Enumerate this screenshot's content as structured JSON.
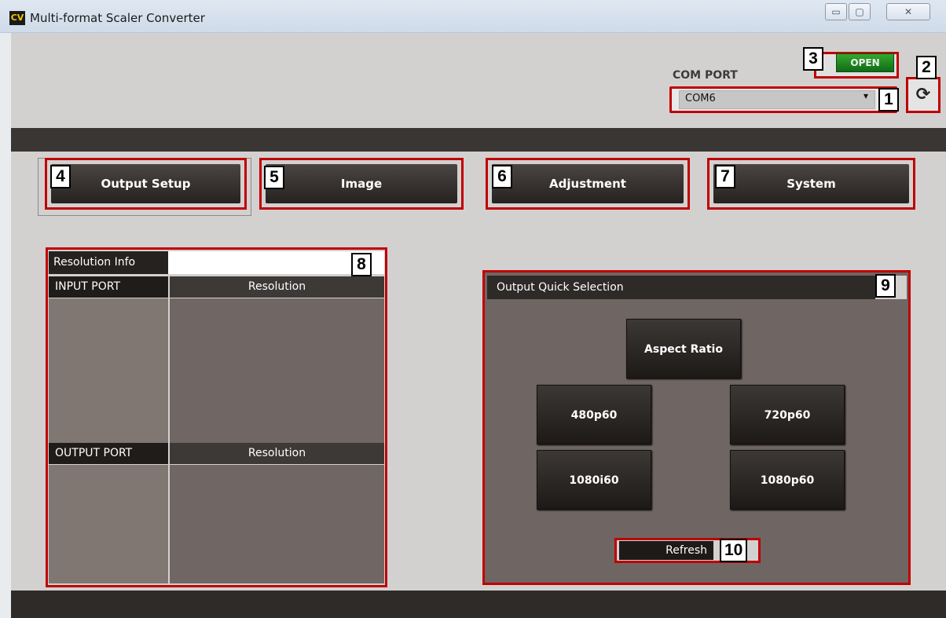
{
  "window": {
    "title": "Multi-format Scaler Converter",
    "icon_text": "CV",
    "controls": {
      "minimize": "▭",
      "maximize": "▢",
      "close": "✕"
    }
  },
  "com_port": {
    "label": "COM PORT",
    "selected": "COM6",
    "arrow": "▾",
    "open_label": "OPEN",
    "refresh_icon": "⟳"
  },
  "tabs": [
    {
      "label": "Output Setup"
    },
    {
      "label": "Image"
    },
    {
      "label": "Adjustment"
    },
    {
      "label": "System"
    }
  ],
  "resolution_info": {
    "title": "Resolution Info",
    "input_port_label": "INPUT PORT",
    "input_resolution_label": "Resolution",
    "output_port_label": "OUTPUT PORT",
    "output_resolution_label": "Resolution"
  },
  "quick_selection": {
    "title": "Output Quick Selection",
    "aspect_ratio": "Aspect Ratio",
    "buttons": [
      "480p60",
      "720p60",
      "1080i60",
      "1080p60"
    ],
    "refresh": "Refresh"
  },
  "callouts": [
    "1",
    "2",
    "3",
    "4",
    "5",
    "6",
    "7",
    "8",
    "9",
    "10"
  ]
}
